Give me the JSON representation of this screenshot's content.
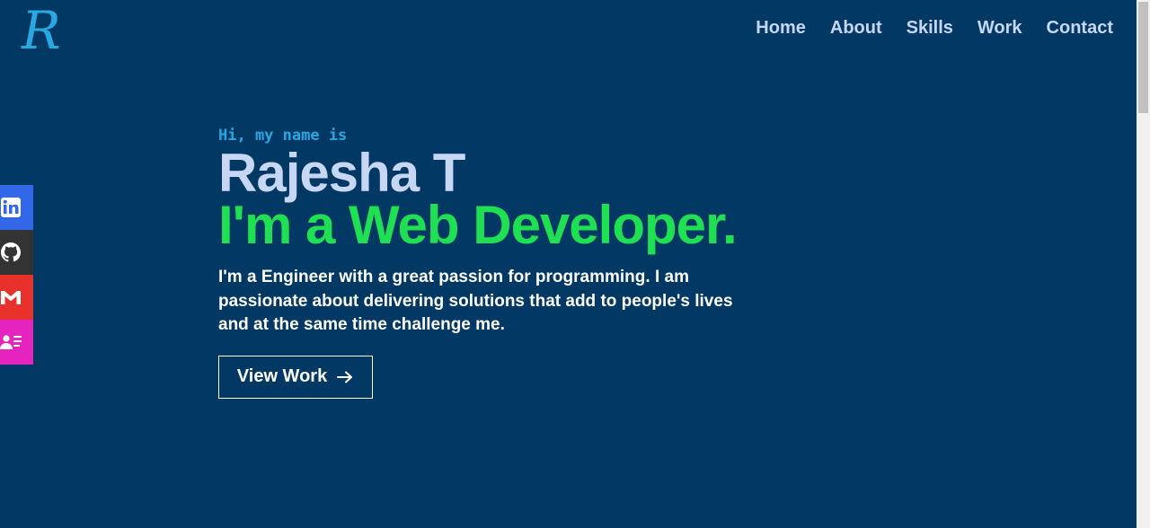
{
  "logo": {
    "letter": "R",
    "color": "#27a8e2"
  },
  "nav": {
    "items": [
      "Home",
      "About",
      "Skills",
      "Work",
      "Contact"
    ]
  },
  "social": [
    {
      "name": "linkedin-icon",
      "color": "#3267e8"
    },
    {
      "name": "github-icon",
      "color": "#333333"
    },
    {
      "name": "gmail-icon",
      "color": "#e8312b"
    },
    {
      "name": "contact-card-icon",
      "color": "#e524c0"
    }
  ],
  "hero": {
    "greeting": "Hi, my name is",
    "name": "Rajesha T",
    "role": "I'm a Web Developer.",
    "bio": "I'm a Engineer with a great passion for programming. I am passionate about delivering solutions that add to people's lives and at the same time challenge me.",
    "button_label": "View Work",
    "button_icon": "arrow-right-icon"
  },
  "colors": {
    "background": "#023864",
    "nav_text": "#c7d6f2",
    "accent_green": "#1fe052",
    "accent_blue": "#27a8e2"
  }
}
